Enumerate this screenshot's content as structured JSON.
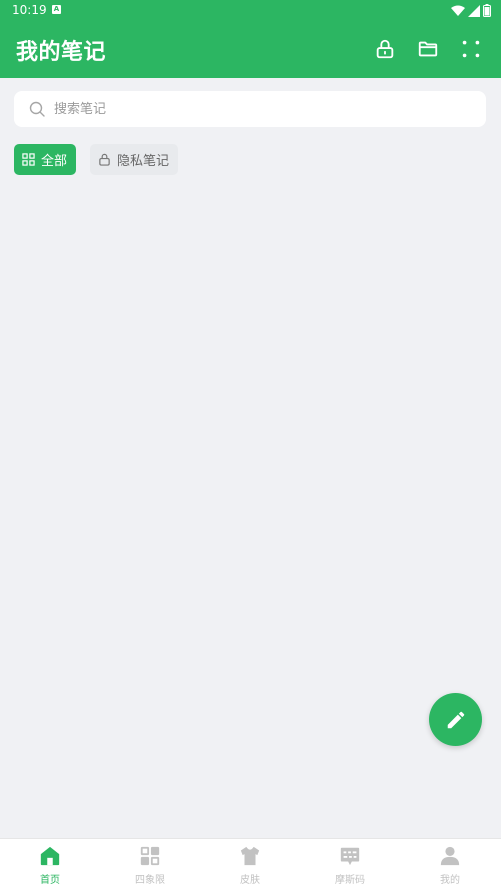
{
  "status_bar": {
    "time": "10:19",
    "notification_badge": "A"
  },
  "header": {
    "title": "我的笔记",
    "icons": [
      "lock-icon",
      "folder-icon",
      "more-icon"
    ]
  },
  "search": {
    "placeholder": "搜索笔记",
    "value": ""
  },
  "filters": [
    {
      "label": "全部",
      "icon": "grid-icon",
      "active": true
    },
    {
      "label": "隐私笔记",
      "icon": "lock-icon",
      "active": false
    }
  ],
  "fab": {
    "icon": "edit-pencil-icon"
  },
  "bottom_nav": [
    {
      "label": "首页",
      "icon": "home-icon",
      "active": true
    },
    {
      "label": "四象限",
      "icon": "quadrant-icon",
      "active": false
    },
    {
      "label": "皮肤",
      "icon": "shirt-icon",
      "active": false
    },
    {
      "label": "摩斯码",
      "icon": "message-code-icon",
      "active": false
    },
    {
      "label": "我的",
      "icon": "person-icon",
      "active": false
    }
  ],
  "colors": {
    "accent": "#2cb662",
    "background": "#f0f1f4",
    "inactive": "#c2c2c2"
  }
}
